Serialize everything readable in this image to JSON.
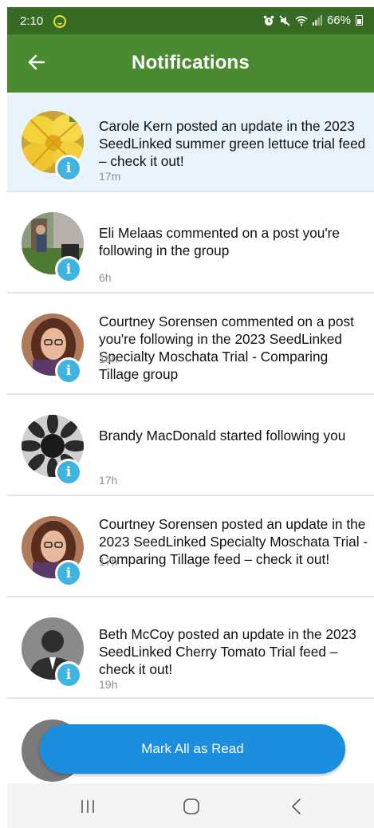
{
  "status_bar": {
    "time": "2:10",
    "battery_percent": "66%",
    "icons": [
      "app-notification-icon",
      "alarm-icon",
      "mute-icon",
      "wifi-icon",
      "signal-icon",
      "battery-icon"
    ]
  },
  "app_bar": {
    "title": "Notifications",
    "back_icon": "arrow-left-icon"
  },
  "notifications": [
    {
      "text": "Carole Kern posted an update in the 2023 SeedLinked summer green lettuce trial feed – check it out!",
      "time": "17m",
      "unread": true,
      "avatar": "yellow-flower"
    },
    {
      "text": "Eli Melaas commented on a post you're following in the  group",
      "time": "6h",
      "unread": false,
      "avatar": "garden-person"
    },
    {
      "text": "Courtney Sorensen commented on a post you're following in the 2023 SeedLinked Specialty Moschata Trial - Comparing Tillage group",
      "time": "16h",
      "unread": false,
      "avatar": "woman-glasses"
    },
    {
      "text": "Brandy MacDonald started following you",
      "time": "17h",
      "unread": false,
      "avatar": "sunflower-bw"
    },
    {
      "text": "Courtney Sorensen posted an update in the 2023 SeedLinked Specialty Moschata Trial - Comparing Tillage feed – check it out!",
      "time": "17h",
      "unread": false,
      "avatar": "woman-glasses"
    },
    {
      "text": "Beth McCoy posted an update in the 2023 SeedLinked Cherry Tomato Trial feed – check it out!",
      "time": "19h",
      "unread": false,
      "avatar": "default-person"
    }
  ],
  "mark_all_button": {
    "label": "Mark All as Read"
  },
  "colors": {
    "status_bar": "#376b24",
    "app_bar": "#4a8b31",
    "unread_bg": "#e8f3fc",
    "info_badge": "#3fb4e0",
    "button": "#1b8ee0"
  },
  "nav_bar": {
    "icons": [
      "recent-apps-icon",
      "home-icon",
      "back-nav-icon"
    ]
  }
}
